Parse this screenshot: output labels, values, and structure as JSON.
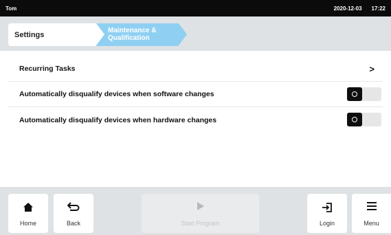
{
  "statusbar": {
    "user": "Tom",
    "date": "2020-12-03",
    "time": "17:22"
  },
  "breadcrumb": {
    "items": [
      {
        "label": "Settings"
      },
      {
        "label_line1": "Maintenance &",
        "label_line2": "Qualification"
      }
    ]
  },
  "settings": {
    "rows": [
      {
        "label": "Recurring Tasks",
        "control": ">"
      },
      {
        "label": "Automatically disqualify devices when software changes",
        "toggle_on": false
      },
      {
        "label": "Automatically disqualify devices when hardware changes",
        "toggle_on": false
      }
    ]
  },
  "navbar": {
    "home_label": "Home",
    "back_label": "Back",
    "start_label": "Start Program",
    "login_label": "Login",
    "menu_label": "Menu"
  },
  "colors": {
    "accent": "#8fd0f2",
    "topbar": "#0b0b0b",
    "chrome": "#dfe2e4"
  },
  "icons": [
    "home-icon",
    "back-arrow-icon",
    "play-icon",
    "login-icon",
    "menu-icon",
    "chevron-right-icon",
    "toggle-knob-icon"
  ]
}
